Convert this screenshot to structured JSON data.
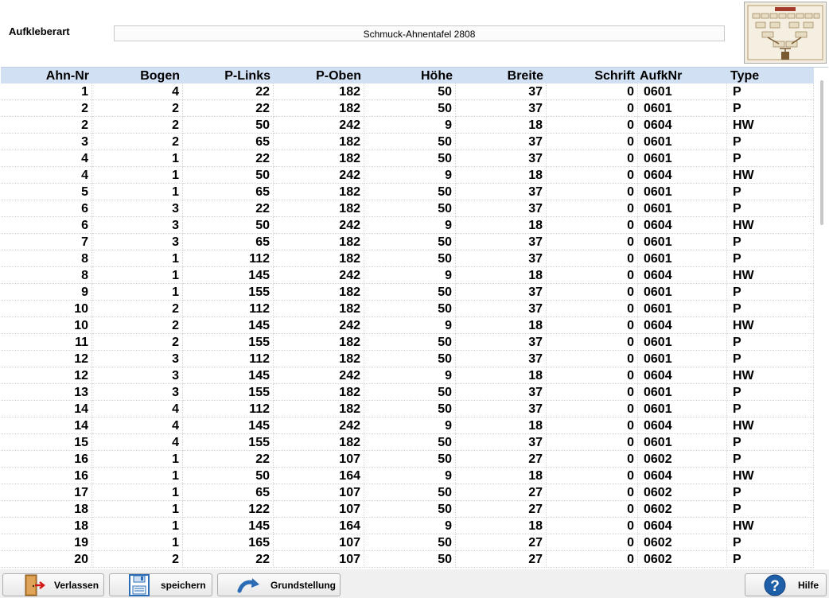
{
  "header": {
    "label": "Aufkleberart",
    "value": "Schmuck-Ahnentafel 2808"
  },
  "thumbnail": {
    "icon": "family-tree-chart-image"
  },
  "table": {
    "columns": [
      "Ahn-Nr",
      "Bogen",
      "P-Links",
      "P-Oben",
      "Höhe",
      "Breite",
      "Schrift",
      "AufkNr",
      "Type"
    ],
    "rows": [
      [
        "1",
        "4",
        "22",
        "182",
        "50",
        "37",
        "0",
        "0601",
        "P"
      ],
      [
        "2",
        "2",
        "22",
        "182",
        "50",
        "37",
        "0",
        "0601",
        "P"
      ],
      [
        "2",
        "2",
        "50",
        "242",
        "9",
        "18",
        "0",
        "0604",
        "HW"
      ],
      [
        "3",
        "2",
        "65",
        "182",
        "50",
        "37",
        "0",
        "0601",
        "P"
      ],
      [
        "4",
        "1",
        "22",
        "182",
        "50",
        "37",
        "0",
        "0601",
        "P"
      ],
      [
        "4",
        "1",
        "50",
        "242",
        "9",
        "18",
        "0",
        "0604",
        "HW"
      ],
      [
        "5",
        "1",
        "65",
        "182",
        "50",
        "37",
        "0",
        "0601",
        "P"
      ],
      [
        "6",
        "3",
        "22",
        "182",
        "50",
        "37",
        "0",
        "0601",
        "P"
      ],
      [
        "6",
        "3",
        "50",
        "242",
        "9",
        "18",
        "0",
        "0604",
        "HW"
      ],
      [
        "7",
        "3",
        "65",
        "182",
        "50",
        "37",
        "0",
        "0601",
        "P"
      ],
      [
        "8",
        "1",
        "112",
        "182",
        "50",
        "37",
        "0",
        "0601",
        "P"
      ],
      [
        "8",
        "1",
        "145",
        "242",
        "9",
        "18",
        "0",
        "0604",
        "HW"
      ],
      [
        "9",
        "1",
        "155",
        "182",
        "50",
        "37",
        "0",
        "0601",
        "P"
      ],
      [
        "10",
        "2",
        "112",
        "182",
        "50",
        "37",
        "0",
        "0601",
        "P"
      ],
      [
        "10",
        "2",
        "145",
        "242",
        "9",
        "18",
        "0",
        "0604",
        "HW"
      ],
      [
        "11",
        "2",
        "155",
        "182",
        "50",
        "37",
        "0",
        "0601",
        "P"
      ],
      [
        "12",
        "3",
        "112",
        "182",
        "50",
        "37",
        "0",
        "0601",
        "P"
      ],
      [
        "12",
        "3",
        "145",
        "242",
        "9",
        "18",
        "0",
        "0604",
        "HW"
      ],
      [
        "13",
        "3",
        "155",
        "182",
        "50",
        "37",
        "0",
        "0601",
        "P"
      ],
      [
        "14",
        "4",
        "112",
        "182",
        "50",
        "37",
        "0",
        "0601",
        "P"
      ],
      [
        "14",
        "4",
        "145",
        "242",
        "9",
        "18",
        "0",
        "0604",
        "HW"
      ],
      [
        "15",
        "4",
        "155",
        "182",
        "50",
        "37",
        "0",
        "0601",
        "P"
      ],
      [
        "16",
        "1",
        "22",
        "107",
        "50",
        "27",
        "0",
        "0602",
        "P"
      ],
      [
        "16",
        "1",
        "50",
        "164",
        "9",
        "18",
        "0",
        "0604",
        "HW"
      ],
      [
        "17",
        "1",
        "65",
        "107",
        "50",
        "27",
        "0",
        "0602",
        "P"
      ],
      [
        "18",
        "1",
        "122",
        "107",
        "50",
        "27",
        "0",
        "0602",
        "P"
      ],
      [
        "18",
        "1",
        "145",
        "164",
        "9",
        "18",
        "0",
        "0604",
        "HW"
      ],
      [
        "19",
        "1",
        "165",
        "107",
        "50",
        "27",
        "0",
        "0602",
        "P"
      ],
      [
        "20",
        "2",
        "22",
        "107",
        "50",
        "27",
        "0",
        "0602",
        "P"
      ]
    ]
  },
  "footer": {
    "exit_label": "Verlassen",
    "save_label": "speichern",
    "reset_label": "Grundstellung",
    "help_label": "Hilfe"
  },
  "colors": {
    "header_bg": "#d2e0f4",
    "footer_bg": "#f0f0f0",
    "help_icon": "#1f5fa8",
    "reset_arrow": "#2c6cb5"
  },
  "icons": {
    "exit": "exit-door-icon",
    "save": "floppy-disk-icon",
    "reset": "curved-arrow-icon",
    "help": "help-question-icon"
  }
}
